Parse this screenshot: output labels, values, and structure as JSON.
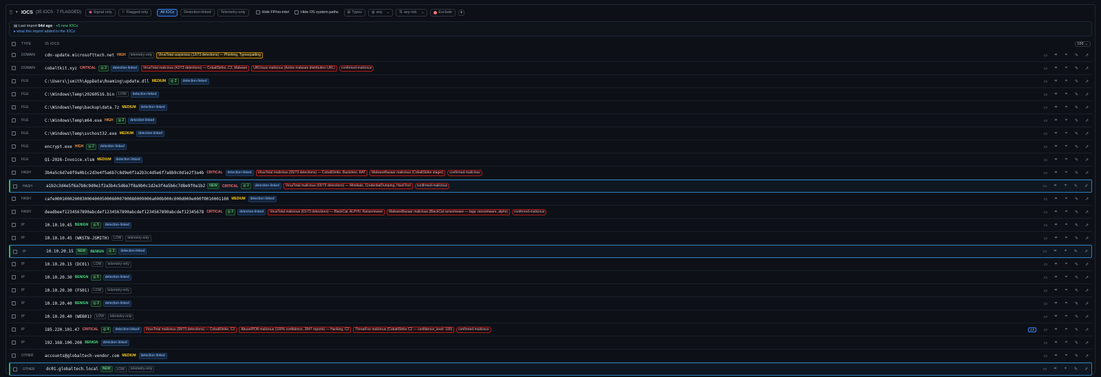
{
  "toolbar": {
    "title": "IOCS",
    "count": "(35 IOCS · 7 FLAGGED)",
    "signal_only": "Signal only",
    "flagged_only": "Flagged only",
    "all_iocs": "All IOCs",
    "detection_linked": "Detection-linked",
    "telemetry_only": "Telemetry-only",
    "hide_fp": "Hide FP/no-intel",
    "hide_os": "Hide OS system paths",
    "types": "Types",
    "any": "any",
    "any_risk": "any risk",
    "exclude": "Exclude",
    "add": "+"
  },
  "import": {
    "label": "Last import",
    "age": "64d ago",
    "new": "+5 new IOCs",
    "link": "what this import added to the IOCs"
  },
  "table": {
    "col_type": "TYPE",
    "col_count": "35 IOCS",
    "per_page": "100"
  },
  "rows": [
    {
      "type": "DOMAIN",
      "value": "cdn-update.microsofttech.net",
      "badges": [
        {
          "k": "sev",
          "t": "HIGH"
        },
        {
          "k": "tel",
          "t": "telemetry-only"
        },
        {
          "k": "yel",
          "t": "VirusTotal suspicious (12/73 detections) — Phishing, Typosquatting"
        }
      ]
    },
    {
      "type": "DOMAIN",
      "value": "cobaltkit.xyz",
      "badges": [
        {
          "k": "sev",
          "t": "CRITICAL"
        },
        {
          "k": "cnt",
          "t": "◎ 2"
        },
        {
          "k": "det",
          "t": "detection-linked"
        },
        {
          "k": "red",
          "t": "VirusTotal malicious (42/73 detections) — CobaltStrike, C2, Malware"
        },
        {
          "k": "red",
          "t": "URLhaus malicious (Active malware distribution URL)"
        },
        {
          "k": "conf",
          "t": "confirmed-malicious"
        }
      ]
    },
    {
      "type": "FILE",
      "value": "C:\\Users\\jsmith\\AppData\\Roaming\\update.dll",
      "badges": [
        {
          "k": "sev",
          "t": "MEDIUM"
        },
        {
          "k": "cnt",
          "t": "◎ 2"
        },
        {
          "k": "det",
          "t": "detection-linked"
        }
      ]
    },
    {
      "type": "FILE",
      "value": "C:\\Windows\\Temp\\20260516.bin",
      "badges": [
        {
          "k": "sev",
          "t": "LOW"
        },
        {
          "k": "det",
          "t": "detection-linked"
        }
      ]
    },
    {
      "type": "FILE",
      "value": "C:\\Windows\\Temp\\backup\\data.7z",
      "badges": [
        {
          "k": "sev",
          "t": "MEDIUM"
        },
        {
          "k": "det",
          "t": "detection-linked"
        }
      ]
    },
    {
      "type": "FILE",
      "value": "C:\\Windows\\Temp\\m64.exe",
      "badges": [
        {
          "k": "sev",
          "t": "HIGH"
        },
        {
          "k": "cnt",
          "t": "◎ 2"
        },
        {
          "k": "det",
          "t": "detection-linked"
        }
      ]
    },
    {
      "type": "FILE",
      "value": "C:\\Windows\\Temp\\svchost32.exe",
      "badges": [
        {
          "k": "sev",
          "t": "MEDIUM"
        },
        {
          "k": "det",
          "t": "detection-linked"
        }
      ]
    },
    {
      "type": "FILE",
      "value": "encrypt.exe",
      "badges": [
        {
          "k": "sev",
          "t": "HIGH"
        },
        {
          "k": "cnt",
          "t": "◎ 2"
        },
        {
          "k": "det",
          "t": "detection-linked"
        }
      ]
    },
    {
      "type": "FILE",
      "value": "Q1-2026-Invoice.xlsm",
      "badges": [
        {
          "k": "sev",
          "t": "MEDIUM"
        },
        {
          "k": "det",
          "t": "detection-linked"
        }
      ]
    },
    {
      "type": "HASH",
      "value": "3b4a5c6d7e8f9a0b1c2d3e4f5a6b7c8d9e0f1a2b3c4d5e6f7a8b9c0d1e2f3a4b",
      "badges": [
        {
          "k": "sev",
          "t": "CRITICAL"
        },
        {
          "k": "det",
          "t": "detection-linked"
        },
        {
          "k": "red",
          "t": "VirusTotal malicious (55/73 detections) — CobaltStrike, Backdoor, RAT"
        },
        {
          "k": "red",
          "t": "MalwareBazaar malicious (CobaltStrike stager)"
        },
        {
          "k": "conf",
          "t": "confirmed-malicious"
        }
      ]
    },
    {
      "type": "HASH",
      "value": "a1b2c3d4e5f6a7b8c9d0e1f2a3b4c5d6e7f8a9b0c1d2e3f4a5b6c7d8e9f0a1b2",
      "new": true,
      "badges": [
        {
          "k": "newt",
          "t": "NEW"
        },
        {
          "k": "sev",
          "t": "CRITICAL"
        },
        {
          "k": "cnt",
          "t": "◎ 2"
        },
        {
          "k": "det",
          "t": "detection-linked"
        },
        {
          "k": "red",
          "t": "VirusTotal malicious (65/73 detections) — Mimikatz, CredentialDumping, HackTool"
        },
        {
          "k": "conf",
          "t": "confirmed-malicious"
        }
      ]
    },
    {
      "type": "HASH",
      "value": "cafe000100020003000400050006000700080009000a000b000c000d000e000f0010001100",
      "badges": [
        {
          "k": "sev",
          "t": "MEDIUM"
        },
        {
          "k": "det",
          "t": "detection-linked"
        }
      ]
    },
    {
      "type": "HASH",
      "value": "deadbeef1234567890abcdef1234567890abcdef1234567890abcdef12345678",
      "badges": [
        {
          "k": "sev",
          "t": "CRITICAL"
        },
        {
          "k": "cnt",
          "t": "◎ 2"
        },
        {
          "k": "det",
          "t": "detection-linked"
        },
        {
          "k": "red",
          "t": "VirusTotal malicious (61/73 detections) — BlackCat, ALPHV, Ransomware"
        },
        {
          "k": "red",
          "t": "MalwareBazaar malicious (BlackCat ransomware — tags: ransomware, alphv)"
        },
        {
          "k": "conf",
          "t": "confirmed-malicious"
        }
      ]
    },
    {
      "type": "IP",
      "value": "10.10.10.45",
      "badges": [
        {
          "k": "sev",
          "t": "BENIGN"
        },
        {
          "k": "cnt",
          "t": "◎ 5"
        },
        {
          "k": "det",
          "t": "detection-linked"
        }
      ]
    },
    {
      "type": "IP",
      "value": "10.10.10.45 (WKSTN-JSMITH)",
      "badges": [
        {
          "k": "sev",
          "t": "LOW"
        },
        {
          "k": "tel",
          "t": "telemetry-only"
        }
      ]
    },
    {
      "type": "IP",
      "value": "10.10.20.15",
      "new": true,
      "badges": [
        {
          "k": "newt",
          "t": "NEW"
        },
        {
          "k": "sev",
          "t": "BENIGN"
        },
        {
          "k": "cnt",
          "t": "◎ 3"
        },
        {
          "k": "det",
          "t": "detection-linked"
        }
      ]
    },
    {
      "type": "IP",
      "value": "10.10.20.15 (DC01)",
      "badges": [
        {
          "k": "sev",
          "t": "LOW"
        },
        {
          "k": "tel",
          "t": "telemetry-only"
        }
      ]
    },
    {
      "type": "IP",
      "value": "10.10.20.30",
      "badges": [
        {
          "k": "sev",
          "t": "BENIGN"
        },
        {
          "k": "cnt",
          "t": "◎ 5"
        },
        {
          "k": "det",
          "t": "detection-linked"
        }
      ]
    },
    {
      "type": "IP",
      "value": "10.10.20.30 (FS01)",
      "badges": [
        {
          "k": "sev",
          "t": "LOW"
        },
        {
          "k": "tel",
          "t": "telemetry-only"
        }
      ]
    },
    {
      "type": "IP",
      "value": "10.10.20.40",
      "badges": [
        {
          "k": "sev",
          "t": "BENIGN"
        },
        {
          "k": "cnt",
          "t": "◎ 3"
        },
        {
          "k": "det",
          "t": "detection-linked"
        }
      ]
    },
    {
      "type": "IP",
      "value": "10.10.20.40 (WEB01)",
      "badges": [
        {
          "k": "sev",
          "t": "LOW"
        },
        {
          "k": "tel",
          "t": "telemetry-only"
        }
      ]
    },
    {
      "type": "IP",
      "value": "185.220.101.47",
      "cti": "C/I",
      "badges": [
        {
          "k": "sev",
          "t": "CRITICAL"
        },
        {
          "k": "cnt",
          "t": "◎ 4"
        },
        {
          "k": "det",
          "t": "detection-linked"
        },
        {
          "k": "red",
          "t": "VirusTotal malicious (58/73 detections) — CobaltStrike, C2"
        },
        {
          "k": "red",
          "t": "AbuseIPDB malicious (100% confidence, 2847 reports) — Hacking, C2"
        },
        {
          "k": "red",
          "t": "ThreatFox malicious (CobaltStrike C2 — confidence_level: 100)"
        },
        {
          "k": "conf",
          "t": "confirmed-malicious"
        }
      ]
    },
    {
      "type": "IP",
      "value": "192.168.100.200",
      "badges": [
        {
          "k": "sev",
          "t": "BENIGN"
        },
        {
          "k": "det",
          "t": "detection-linked"
        }
      ]
    },
    {
      "type": "OTHER",
      "value": "accounts@globaltech-vendor.com",
      "badges": [
        {
          "k": "sev",
          "t": "MEDIUM"
        },
        {
          "k": "det",
          "t": "detection-linked"
        }
      ]
    },
    {
      "type": "OTHER",
      "value": "dc01.globaltech.local",
      "new": true,
      "badges": [
        {
          "k": "newt",
          "t": "NEW"
        },
        {
          "k": "sev",
          "t": "LOW"
        },
        {
          "k": "tel",
          "t": "telemetry-only"
        }
      ]
    }
  ],
  "row_actions": [
    "comment-icon",
    "tag-icon",
    "pin-icon",
    "edit-icon",
    "link-icon"
  ]
}
